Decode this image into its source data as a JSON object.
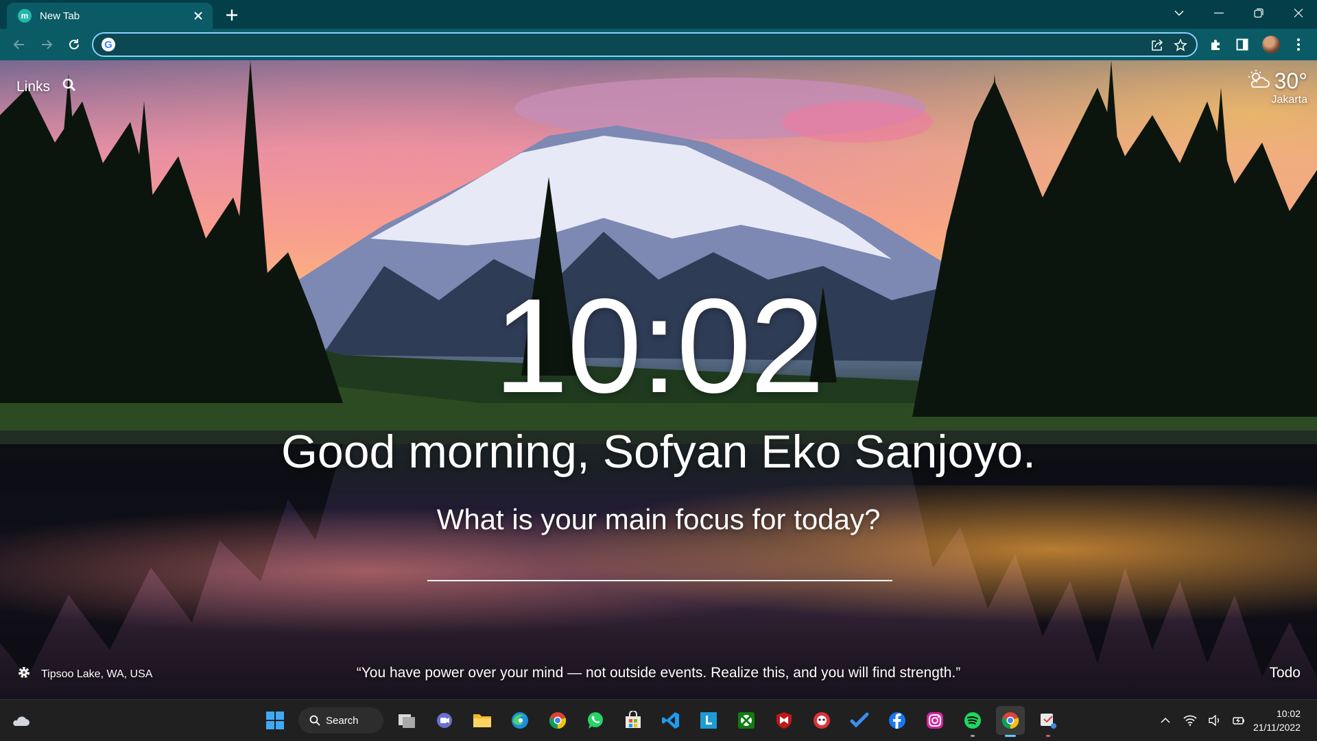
{
  "browser": {
    "tab_title": "New Tab",
    "tab_favicon_letter": "m",
    "omnibox_value": "",
    "omnibox_placeholder": "",
    "accent_color": "#0b5b66"
  },
  "links": {
    "label": "Links"
  },
  "weather": {
    "temperature": "30°",
    "city": "Jakarta",
    "icon": "partly-cloudy-icon"
  },
  "clock": {
    "time": "10:02"
  },
  "greeting": "Good morning, Sofyan Eko Sanjoyo.",
  "focus": {
    "question": "What is your main focus for today?",
    "value": ""
  },
  "photo": {
    "location": "Tipsoo Lake, WA, USA"
  },
  "quote": "“You have power over your mind — not outside events. Realize this, and you will find strength.”",
  "todo_label": "Todo",
  "taskbar": {
    "search_label": "Search",
    "apps": [
      "start",
      "search",
      "task-view",
      "teams",
      "file-explorer",
      "edge",
      "chrome",
      "whatsapp",
      "microsoft-store",
      "vs-code",
      "lightroom",
      "xbox",
      "mcafee",
      "cuphead",
      "todo",
      "facebook",
      "instagram",
      "spotify",
      "chrome-profile",
      "snipping-tool"
    ],
    "time": "10:02",
    "date": "21/11/2022"
  }
}
